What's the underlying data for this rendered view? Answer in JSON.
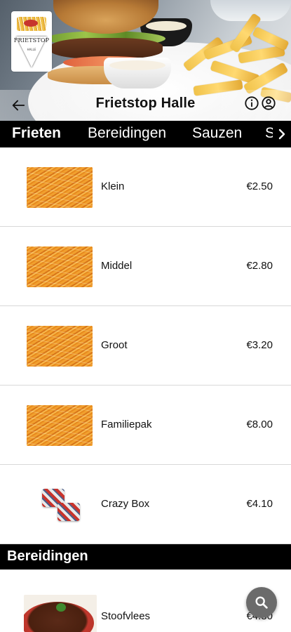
{
  "header": {
    "title": "Frietstop Halle",
    "logo_text": "FRIETSTOP",
    "logo_subtext": "HALLE",
    "back_icon": "arrow-left-icon",
    "info_icon": "info-circle-icon",
    "account_icon": "account-circle-icon"
  },
  "tabs": [
    {
      "label": "Frieten",
      "active": true
    },
    {
      "label": "Bereidingen",
      "active": false
    },
    {
      "label": "Sauzen",
      "active": false
    },
    {
      "label": "Snacks",
      "active": false
    }
  ],
  "tabs_more_icon": "chevron-right-icon",
  "sections": [
    {
      "title": "Frieten",
      "items": [
        {
          "name": "Klein",
          "price": "€2.50",
          "image": "fries"
        },
        {
          "name": "Middel",
          "price": "€2.80",
          "image": "fries"
        },
        {
          "name": "Groot",
          "price": "€3.20",
          "image": "fries"
        },
        {
          "name": "Familiepak",
          "price": "€8.00",
          "image": "fries"
        },
        {
          "name": "Crazy Box",
          "price": "€4.10",
          "image": "boxes"
        }
      ]
    },
    {
      "title": "Bereidingen",
      "items": [
        {
          "name": "Stoofvlees",
          "price": "€4.80",
          "image": "stew"
        }
      ]
    }
  ],
  "search_fab_icon": "search-icon",
  "colors": {
    "tab_bar_bg": "#000000",
    "tab_text": "#ffffff",
    "divider": "#d8d8d8",
    "fab_bg": "#6b6b6b"
  }
}
